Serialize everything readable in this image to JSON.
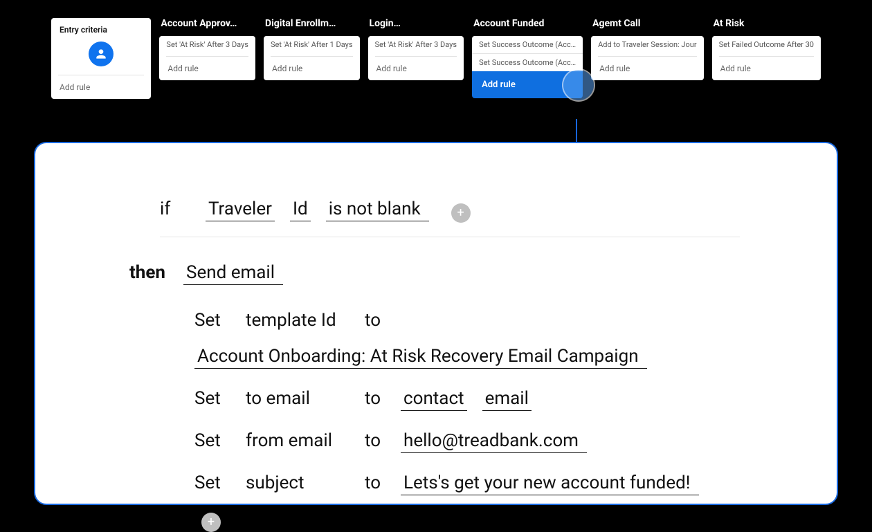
{
  "entry": {
    "title": "Entry criteria",
    "add_rule": "Add rule"
  },
  "stages": [
    {
      "title": "Account Approv…",
      "rules": [
        "Set 'At Risk' After 3 Days"
      ],
      "add_rule": "Add rule"
    },
    {
      "title": "Digital Enrollm…",
      "rules": [
        "Set 'At Risk' After 1 Days"
      ],
      "add_rule": "Add rule"
    },
    {
      "title": "Login…",
      "rules": [
        "Set 'At Risk' After 3 Days"
      ],
      "add_rule": "Add rule"
    },
    {
      "title": "Account Funded",
      "rules": [
        "Set Success Outcome (Acc…",
        "Set Success Outcome (Acc…"
      ],
      "add_rule": "Add rule",
      "selected": true
    },
    {
      "title": "Agemt Call",
      "rules": [
        "Add to Traveler Session: Jour"
      ],
      "add_rule": "Add rule"
    },
    {
      "title": "At Risk",
      "rules": [
        "Set Failed Outcome After 30"
      ],
      "add_rule": "Add rule"
    }
  ],
  "editor": {
    "if_kw": "if",
    "then_kw": "then",
    "set_kw": "Set",
    "to_kw": "to",
    "condition": {
      "field_group": "Traveler",
      "field": "Id",
      "op": "is not blank"
    },
    "action": {
      "label": "Send email"
    },
    "rows": [
      {
        "field": "template Id",
        "value": "Account Onboarding: At Risk Recovery Email Campaign"
      },
      {
        "field": "to email",
        "value_tokens": [
          "contact",
          "email"
        ]
      },
      {
        "field": "from email",
        "value": "hello@treadbank.com"
      },
      {
        "field": "subject",
        "value": "Lets's get your new account funded!"
      }
    ]
  }
}
